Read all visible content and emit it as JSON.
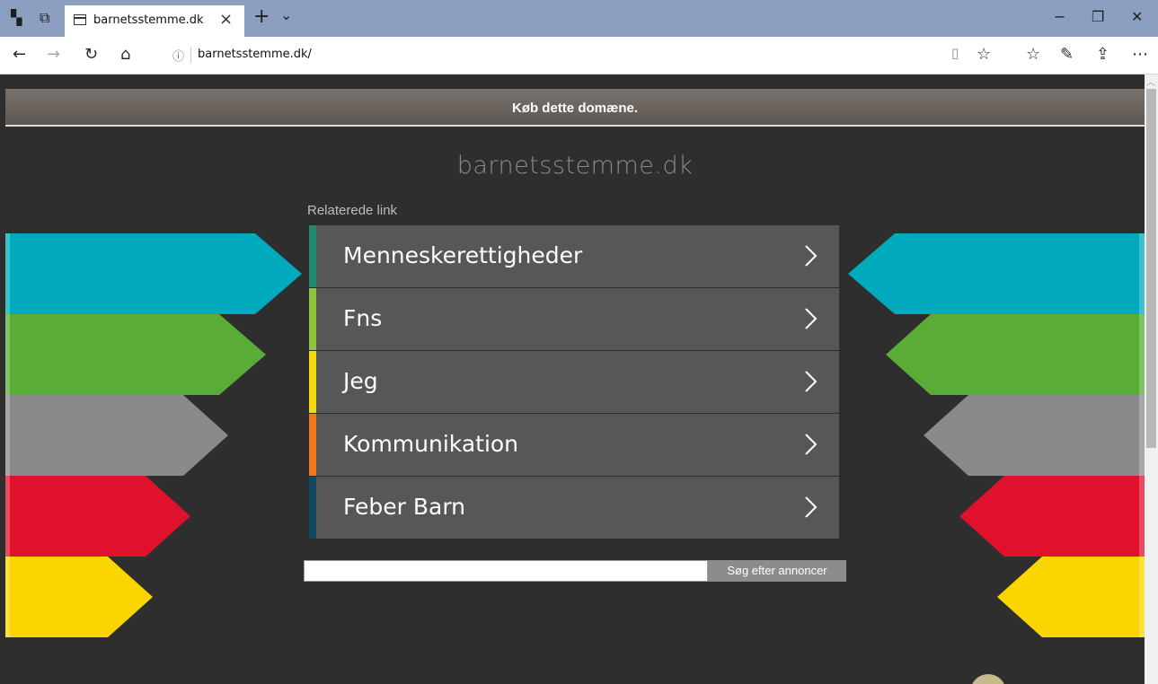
{
  "browser": {
    "tab_title": "barnetsstemme.dk",
    "url": "barnetsstemme.dk/"
  },
  "icons": {
    "tab_actions": [
      "set-aside-tabs-icon",
      "tab-preview-icon"
    ],
    "new_tab": "plus-icon",
    "tab_list": "chevron-down-icon",
    "window": [
      "minimize-icon",
      "restore-icon",
      "close-icon"
    ],
    "nav": [
      "back-icon",
      "forward-icon",
      "refresh-icon",
      "home-icon"
    ],
    "address": [
      "reading-view-icon",
      "favorite-star-icon"
    ],
    "toolbar": [
      "favorites-hub-icon",
      "web-note-icon",
      "share-icon",
      "more-icon"
    ]
  },
  "page": {
    "buy_domain": "Køb dette domæne.",
    "site_name": "barnetsstemme.dk",
    "related_heading": "Relaterede link",
    "links": [
      {
        "label": "Menneskerettigheder",
        "accent": "#1f8a70"
      },
      {
        "label": "Fns",
        "accent": "#8cc43c"
      },
      {
        "label": "Jeg",
        "accent": "#f5d90a"
      },
      {
        "label": "Kommunikation",
        "accent": "#f07818"
      },
      {
        "label": "Feber Barn",
        "accent": "#0f4a60"
      }
    ],
    "search_placeholder": "",
    "search_button": "Søg efter annoncer"
  },
  "colors": {
    "background": "#2e2e2e",
    "link_bg": "#575757",
    "bands": [
      "#00aabd",
      "#5aac36",
      "#8a8a8a",
      "#e0112d",
      "#fbd500"
    ]
  }
}
